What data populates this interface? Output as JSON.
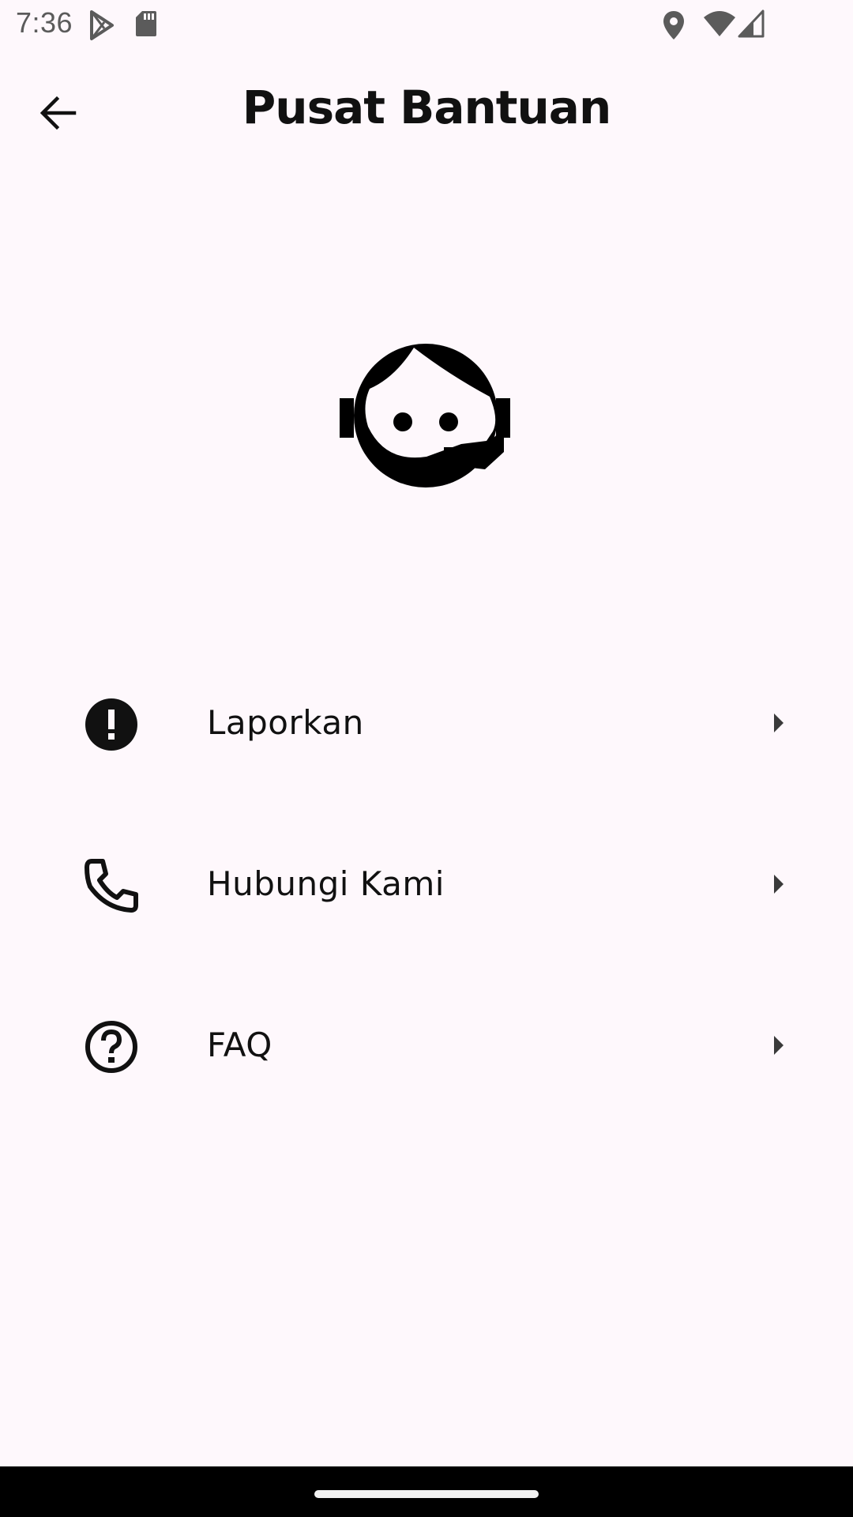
{
  "status_bar": {
    "time": "7:36",
    "icons": [
      "play-store-icon",
      "sd-card-icon",
      "location-icon",
      "wifi-icon",
      "cell-signal-icon"
    ]
  },
  "app_bar": {
    "title": "Pusat Bantuan",
    "back_icon": "arrow-back-icon"
  },
  "hero": {
    "icon": "support-agent-icon"
  },
  "menu": {
    "items": [
      {
        "label": "Laporkan",
        "icon": "report-icon"
      },
      {
        "label": "Hubungi Kami",
        "icon": "phone-icon"
      },
      {
        "label": "FAQ",
        "icon": "help-icon"
      }
    ],
    "trailing_icon": "arrow-right-icon"
  },
  "colors": {
    "background": "#fef8fc",
    "text": "#111111",
    "status_text": "#5b5b5b",
    "nav_bar": "#000000"
  }
}
